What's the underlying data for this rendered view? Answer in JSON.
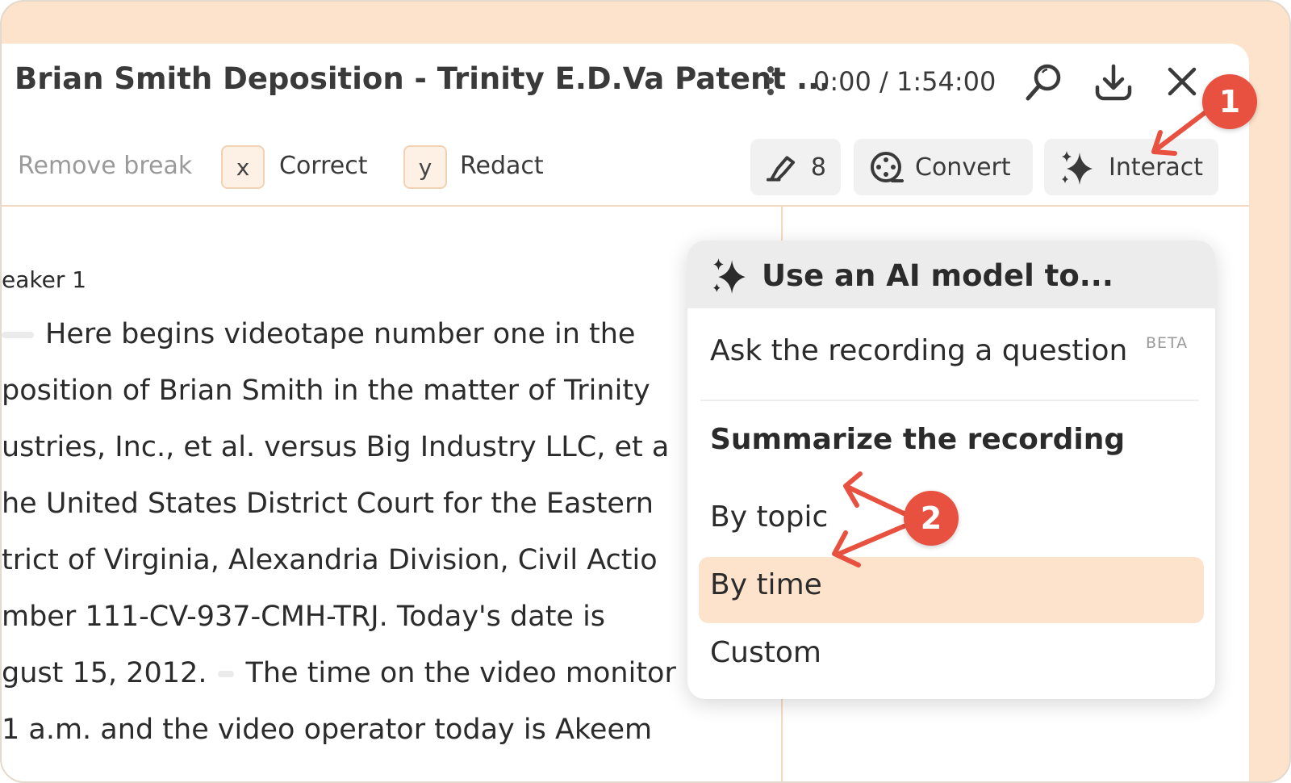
{
  "window": {
    "title": "Brian Smith Deposition - Trinity E.D.Va Patent ...",
    "time": "0:00 / 1:54:00",
    "icons": [
      "more-vertical-icon",
      "search-icon",
      "download-icon",
      "close-icon"
    ]
  },
  "toolbar": {
    "remove_break": "Remove break",
    "correct_key": "x",
    "correct_label": "Correct",
    "redact_key": "y",
    "redact_label": "Redact",
    "highlight_count": "8",
    "convert_label": "Convert",
    "interact_label": "Interact"
  },
  "transcript": {
    "speaker": "eaker 1",
    "lines": [
      "Here begins videotape number one in the",
      "position of Brian Smith in the matter of Trinity",
      "ustries, Inc., et al. versus Big Industry LLC, et a",
      "he United States District Court for the Eastern",
      "trict of Virginia, Alexandria Division, Civil Actio",
      "mber 111-CV-937-CMH-TRJ. Today's date is",
      "gust 15, 2012.",
      "The time on the video monitor is",
      "1 a.m. and the video operator today is Akeem"
    ]
  },
  "menu": {
    "header": "Use an AI model to...",
    "ask": "Ask the recording a question",
    "beta": "BETA",
    "summarize": "Summarize the recording",
    "by_topic": "By topic",
    "by_time": "By time",
    "custom": "Custom",
    "selected": "By time"
  },
  "annotations": {
    "badge1": "1",
    "badge2": "2",
    "color": "#e8503f"
  },
  "colors": {
    "frame_background": "#fde3cb",
    "highlight": "#fde3cb",
    "accent": "#e8503f"
  }
}
